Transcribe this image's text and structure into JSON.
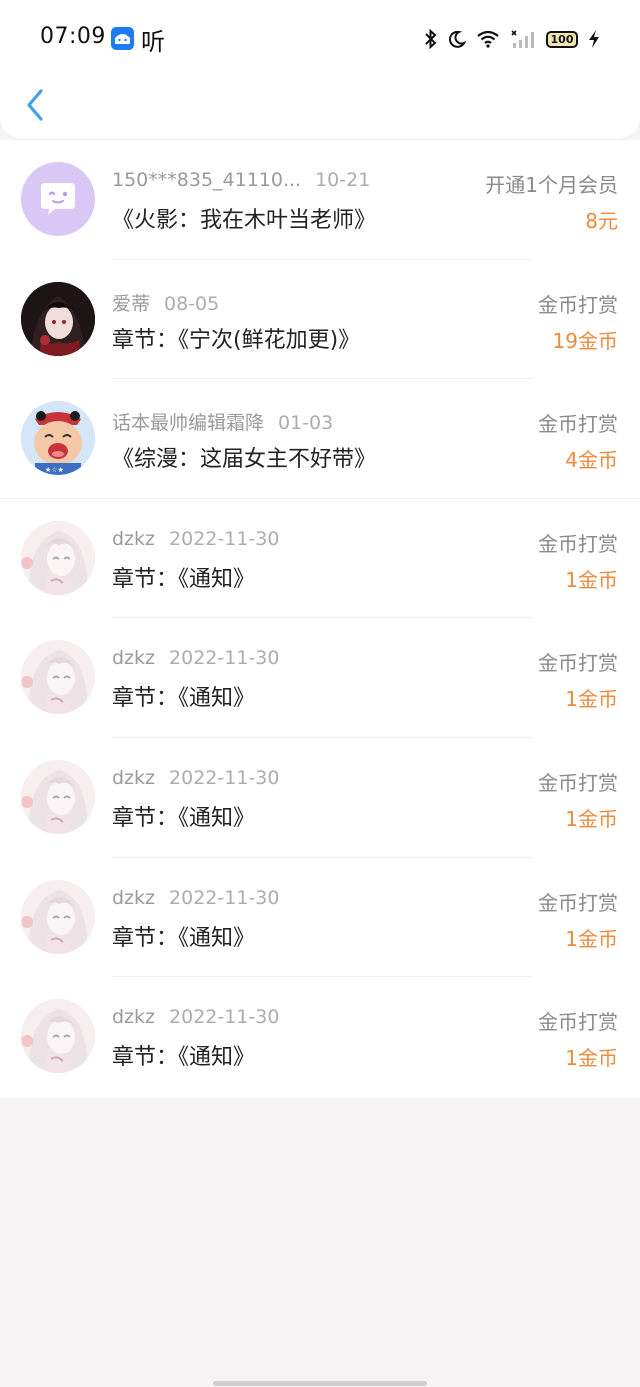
{
  "status_bar": {
    "time": "07:09",
    "app_label": "听",
    "battery": "100",
    "icons": [
      "bluetooth-icon",
      "moon-icon",
      "wifi-icon",
      "signal-icon",
      "battery-icon",
      "charging-icon"
    ]
  },
  "header": {
    "back_icon": "chevron-left-icon"
  },
  "colors": {
    "accent": "#3fa2e8",
    "amount": "#ee8a3c",
    "avatar_chat": "#d9c7f6"
  },
  "records": [
    {
      "user": "150***835_41110...",
      "date": "10-21",
      "title": "《火影：我在木叶当老师》",
      "type": "开通1个月会员",
      "amount": "8元",
      "avatar": "chat-bubble-avatar"
    },
    {
      "user": "爱蒂",
      "date": "08-05",
      "title": "章节：《宁次(鲜花加更)》",
      "type": "金币打赏",
      "amount": "19金币",
      "avatar": "dark-hair-girl-avatar"
    },
    {
      "user": "话本最帅编辑霜降",
      "date": "01-03",
      "title": "《综漫：这届女主不好带》",
      "type": "金币打赏",
      "amount": "4金币",
      "avatar": "cartoon-kid-avatar"
    },
    {
      "user": "dzkz",
      "date": "2022-11-30",
      "title": "章节：《通知》",
      "type": "金币打赏",
      "amount": "1金币",
      "avatar": "white-hair-girl-avatar"
    },
    {
      "user": "dzkz",
      "date": "2022-11-30",
      "title": "章节：《通知》",
      "type": "金币打赏",
      "amount": "1金币",
      "avatar": "white-hair-girl-avatar"
    },
    {
      "user": "dzkz",
      "date": "2022-11-30",
      "title": "章节：《通知》",
      "type": "金币打赏",
      "amount": "1金币",
      "avatar": "white-hair-girl-avatar"
    },
    {
      "user": "dzkz",
      "date": "2022-11-30",
      "title": "章节：《通知》",
      "type": "金币打赏",
      "amount": "1金币",
      "avatar": "white-hair-girl-avatar"
    },
    {
      "user": "dzkz",
      "date": "2022-11-30",
      "title": "章节：《通知》",
      "type": "金币打赏",
      "amount": "1金币",
      "avatar": "white-hair-girl-avatar"
    }
  ]
}
